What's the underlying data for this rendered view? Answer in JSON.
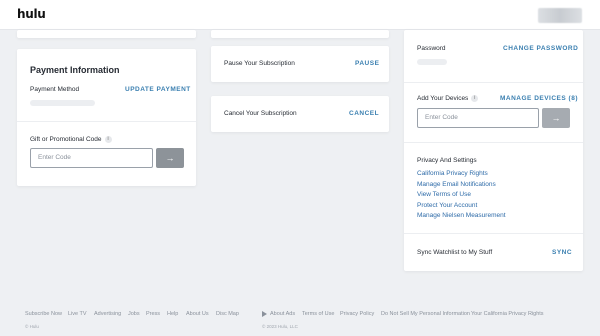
{
  "header": {
    "logo": "hulu"
  },
  "payment": {
    "title": "Payment Information",
    "method_label": "Payment Method",
    "update_label": "UPDATE PAYMENT",
    "gift_label": "Gift or Promotional Code",
    "gift_placeholder": "Enter Code",
    "info_glyph": "i"
  },
  "subscription": {
    "pause_label": "Pause Your Subscription",
    "pause_action": "PAUSE",
    "cancel_label": "Cancel Your Subscription",
    "cancel_action": "CANCEL"
  },
  "account": {
    "password_label": "Password",
    "change_password": "CHANGE PASSWORD",
    "devices_label": "Add Your Devices",
    "manage_devices": "MANAGE DEVICES (8)",
    "device_placeholder": "Enter Code",
    "privacy_title": "Privacy And Settings",
    "privacy_links": [
      "California Privacy Rights",
      "Manage Email Notifications",
      "View Terms of Use",
      "Protect Your Account",
      "Manage Nielsen Measurement"
    ],
    "sync_label": "Sync Watchlist to My Stuff",
    "sync_action": "SYNC"
  },
  "footer": {
    "links_left": [
      "Subscribe Now",
      "Live TV",
      "Advertising",
      "Jobs",
      "Press",
      "Help",
      "About Us",
      "Disc Map"
    ],
    "links_right": [
      "About Ads",
      "Terms of Use",
      "Privacy Policy",
      "Do Not Sell My Personal Information",
      "Your California Privacy Rights"
    ],
    "copyright": "© Hulu",
    "sub_right": "© 2023 Hulu, LLC"
  },
  "icons": {
    "arrow": "arrow-right-icon",
    "play": "play-icon",
    "info": "info-icon"
  },
  "colors": {
    "accent": "#3a7fb0",
    "link": "#2e6ba8",
    "background": "#eef0f3"
  }
}
